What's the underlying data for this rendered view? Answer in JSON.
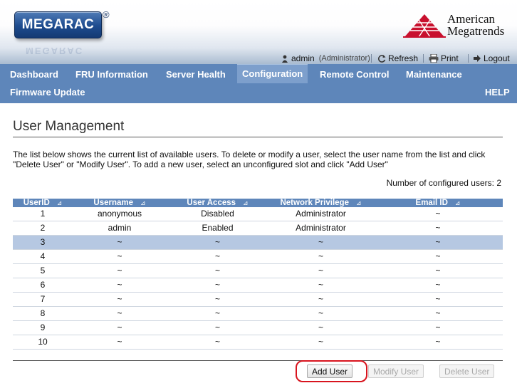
{
  "brand": {
    "logo_text": "MEGARAC",
    "registered_mark": "®",
    "vendor_line1": "American",
    "vendor_line2": "Megatrends"
  },
  "user_bar": {
    "username": "admin",
    "role": "(Administrator)",
    "refresh": "Refresh",
    "print": "Print",
    "logout": "Logout"
  },
  "nav": {
    "items": [
      {
        "label": "Dashboard"
      },
      {
        "label": "FRU Information"
      },
      {
        "label": "Server Health"
      },
      {
        "label": "Configuration",
        "active": true
      },
      {
        "label": "Remote Control"
      },
      {
        "label": "Maintenance"
      },
      {
        "label": "Firmware Update"
      }
    ],
    "help": "HELP"
  },
  "page": {
    "title": "User Management",
    "description": "The list below shows the current list of available users. To delete or modify a user, select the user name from the list and click \"Delete User\" or \"Modify User\". To add a new user, select an unconfigured slot and click \"Add User\"",
    "count_label": "Number of configured users: 2"
  },
  "table": {
    "columns": [
      "UserID",
      "Username",
      "User Access",
      "Network Privilege",
      "Email ID"
    ],
    "sort_glyph": "⊿",
    "rows": [
      [
        "1",
        "anonymous",
        "Disabled",
        "Administrator",
        "~"
      ],
      [
        "2",
        "admin",
        "Enabled",
        "Administrator",
        "~"
      ],
      [
        "3",
        "~",
        "~",
        "~",
        "~"
      ],
      [
        "4",
        "~",
        "~",
        "~",
        "~"
      ],
      [
        "5",
        "~",
        "~",
        "~",
        "~"
      ],
      [
        "6",
        "~",
        "~",
        "~",
        "~"
      ],
      [
        "7",
        "~",
        "~",
        "~",
        "~"
      ],
      [
        "8",
        "~",
        "~",
        "~",
        "~"
      ],
      [
        "9",
        "~",
        "~",
        "~",
        "~"
      ],
      [
        "10",
        "~",
        "~",
        "~",
        "~"
      ]
    ],
    "selected_row": "3"
  },
  "buttons": {
    "add": "Add User",
    "modify": "Modify User",
    "delete": "Delete User"
  },
  "colors": {
    "nav_bg": "#5e86ba",
    "nav_active": "#7d9fcc",
    "selected_row": "#b6c8e2",
    "highlight": "#d8141e",
    "vendor_red": "#c8102e"
  }
}
